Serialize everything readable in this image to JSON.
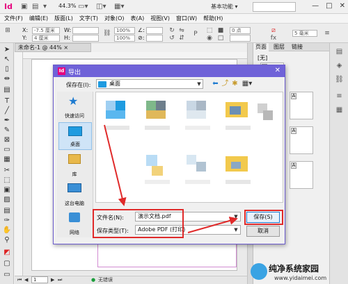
{
  "app": {
    "logo": "Id",
    "zoom": "44.3%",
    "workspace": "基本功能",
    "workspace_arrow": "▾",
    "window_buttons": [
      "—",
      "□",
      "✕"
    ]
  },
  "menu": [
    "文件(F)",
    "编辑(E)",
    "版面(L)",
    "文字(T)",
    "对象(O)",
    "表(A)",
    "视图(V)",
    "窗口(W)",
    "帮助(H)"
  ],
  "control": {
    "x_label": "X:",
    "x_value": "-7.5 厘米",
    "y_label": "Y:",
    "y_value": "4 厘米",
    "w_label": "W:",
    "h_label": "H:",
    "angle_label": "∠:",
    "shear_label": "⊘:",
    "zoom_pct": "100%",
    "stroke_value": "0 点",
    "sp_value": "5 毫米"
  },
  "document": {
    "tab": "未命名-1 @ 44%",
    "tab_close": "×",
    "status_page": "1",
    "status_state": "无错误"
  },
  "pages_panel": {
    "tab_pages": "页面",
    "tab_layers": "图层",
    "tab_links": "链接",
    "none_label": "[无]",
    "master_label": "A",
    "page_label": "A"
  },
  "dialog": {
    "title": "导出",
    "logo": "Id",
    "close": "✕",
    "save_in_label": "保存在(I):",
    "save_in_value": "桌面",
    "places": [
      {
        "label": "快速访问",
        "icon": "star-icon"
      },
      {
        "label": "桌面",
        "icon": "desktop-icon"
      },
      {
        "label": "库",
        "icon": "library-icon"
      },
      {
        "label": "这台电脑",
        "icon": "computer-icon"
      },
      {
        "label": "网络",
        "icon": "network-icon"
      }
    ],
    "filename_label": "文件名(N):",
    "filename_value": "演示文档.pdf",
    "filetype_label": "保存类型(T):",
    "filetype_value": "Adobe PDF (打印)",
    "save_button": "保存(S)",
    "cancel_button": "取消"
  },
  "watermark": {
    "name": "纯净系统家园",
    "url": "www.yidaimei.com"
  }
}
